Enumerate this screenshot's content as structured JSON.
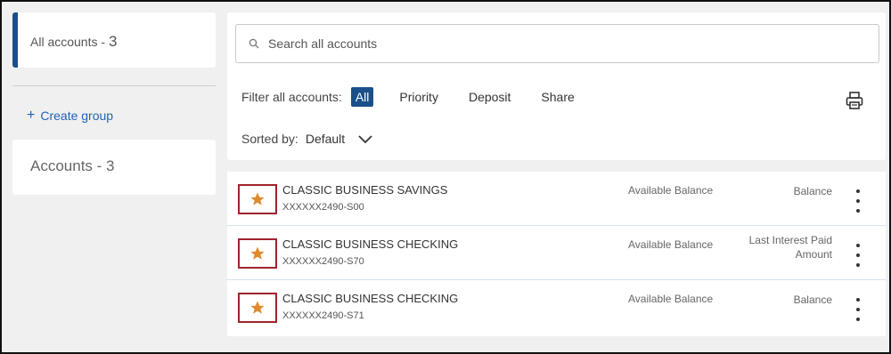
{
  "sidebar": {
    "all_accounts": {
      "label": "All accounts - ",
      "count": "3"
    },
    "create_group": {
      "icon": "plus-icon",
      "label": "Create group"
    },
    "accounts_group": {
      "label": "Accounts - 3"
    }
  },
  "search": {
    "placeholder": "Search all accounts",
    "value": ""
  },
  "filter": {
    "label": "Filter all accounts:",
    "options": [
      "All",
      "Priority",
      "Deposit",
      "Share"
    ],
    "selected": "All"
  },
  "sort": {
    "label": "Sorted by:",
    "value": "Default"
  },
  "colors": {
    "accent": "#1b4f8a",
    "star": "#e08a2e",
    "star_border": "#a0232b",
    "link": "#1e63b5"
  },
  "accounts": [
    {
      "name": "CLASSIC BUSINESS SAVINGS",
      "number": "XXXXXX2490-S00",
      "available": "Available Balance",
      "balance": "Balance"
    },
    {
      "name": "CLASSIC BUSINESS CHECKING",
      "number": "XXXXXX2490-S70",
      "available": "Available Balance",
      "balance": "Last Interest Paid Amount"
    },
    {
      "name": "CLASSIC BUSINESS CHECKING",
      "number": "XXXXXX2490-S71",
      "available": "Available Balance",
      "balance": "Balance"
    }
  ]
}
